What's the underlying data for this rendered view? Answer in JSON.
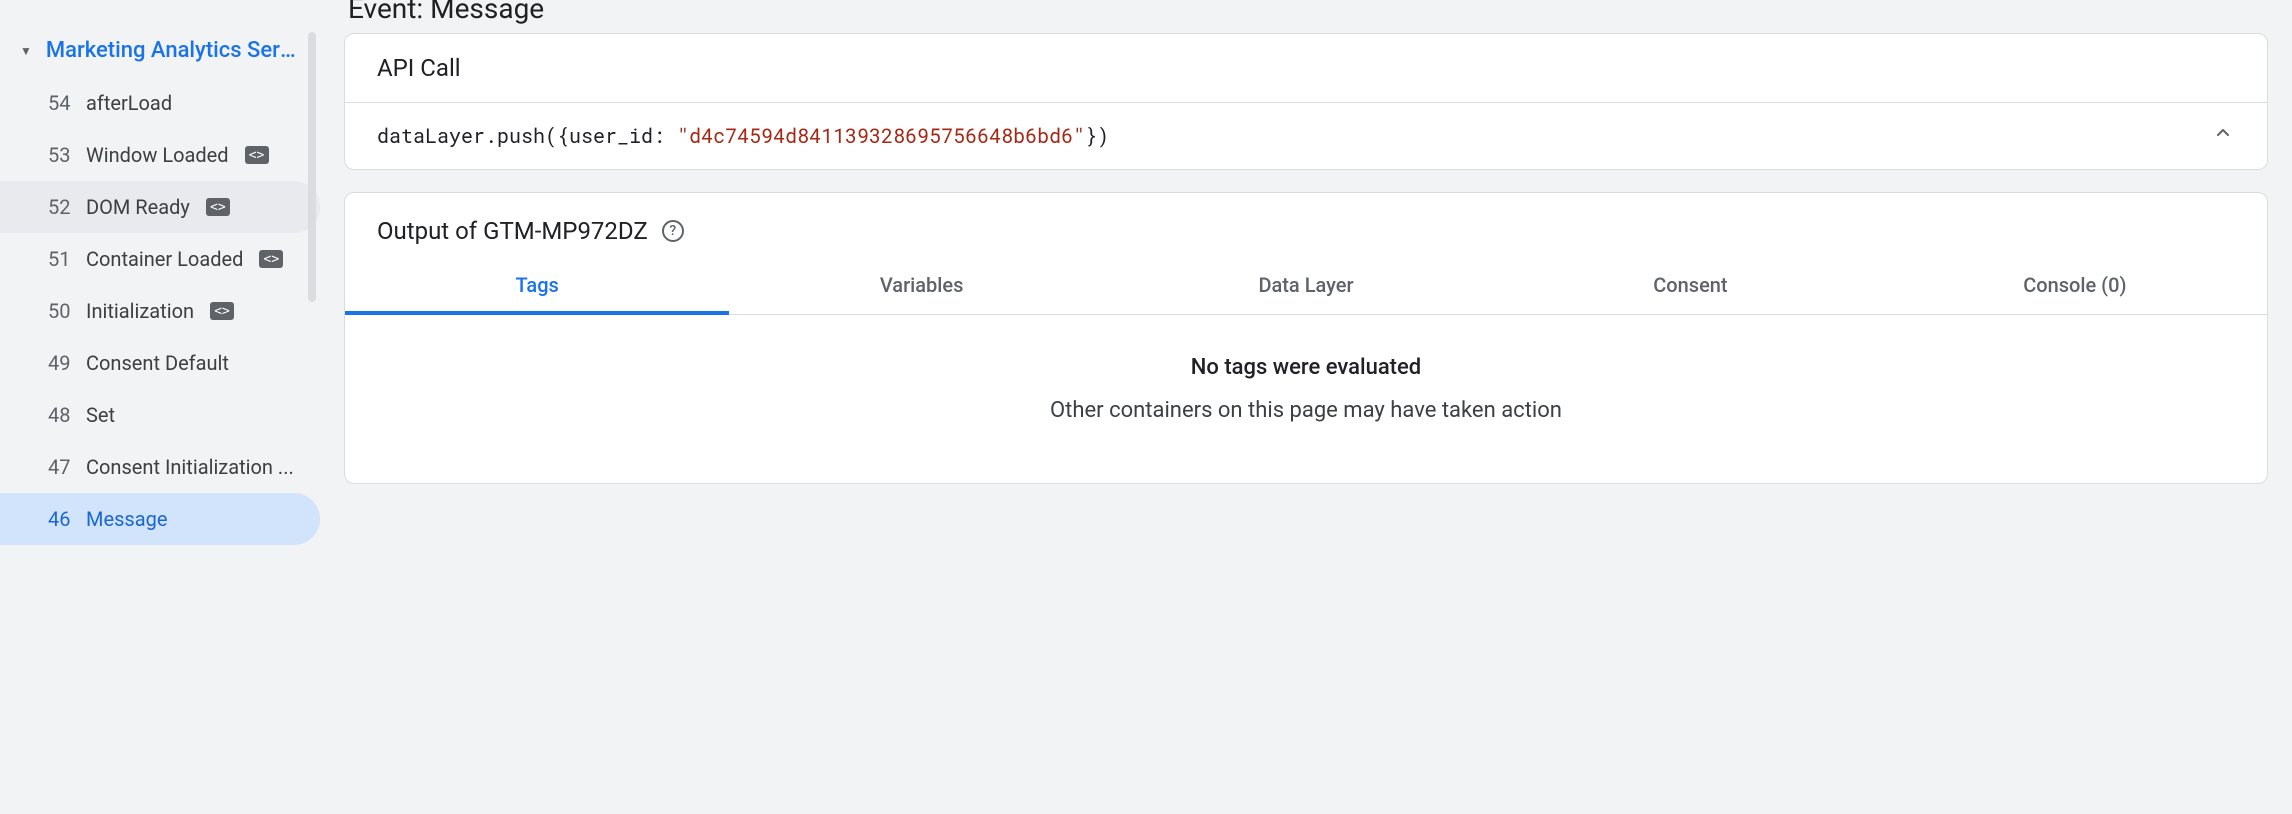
{
  "sidebar": {
    "header": "Marketing Analytics Servi...",
    "items": [
      {
        "num": "54",
        "label": "afterLoad",
        "code_icon": false
      },
      {
        "num": "53",
        "label": "Window Loaded",
        "code_icon": true
      },
      {
        "num": "52",
        "label": "DOM Ready",
        "code_icon": true,
        "selected": true
      },
      {
        "num": "51",
        "label": "Container Loaded",
        "code_icon": true
      },
      {
        "num": "50",
        "label": "Initialization",
        "code_icon": true
      },
      {
        "num": "49",
        "label": "Consent Default",
        "code_icon": false
      },
      {
        "num": "48",
        "label": "Set",
        "code_icon": false
      },
      {
        "num": "47",
        "label": "Consent Initialization ...",
        "code_icon": false
      },
      {
        "num": "46",
        "label": "Message",
        "code_icon": false,
        "selected_msg": true
      }
    ]
  },
  "main": {
    "title": "Event: Message",
    "api_call_header": "API Call",
    "api_call_code_prefix": "dataLayer.push({user_id: ",
    "api_call_code_string": "\"d4c74594d841139328695756648b6bd6\"",
    "api_call_code_suffix": "})",
    "output_title": "Output of GTM-MP972DZ",
    "tabs": [
      {
        "label": "Tags",
        "active": true
      },
      {
        "label": "Variables"
      },
      {
        "label": "Data Layer"
      },
      {
        "label": "Consent"
      },
      {
        "label": "Console (0)"
      }
    ],
    "no_tags_title": "No tags were evaluated",
    "no_tags_sub": "Other containers on this page may have taken action"
  }
}
